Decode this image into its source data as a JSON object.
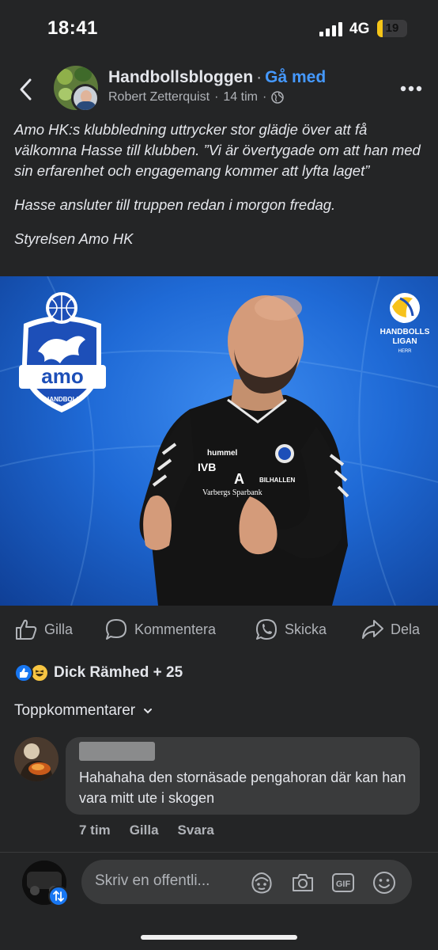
{
  "status_bar": {
    "time": "18:41",
    "network": "4G",
    "battery": "19",
    "battery_level": 0.19
  },
  "header": {
    "group_name": "Handbollsbloggen",
    "separator": "·",
    "join_label": "Gå med",
    "author": "Robert Zetterquist",
    "dot": "·",
    "time_ago": "14 tim",
    "back_icon": "chevron-left-icon",
    "more_icon": "more-horizontal-icon",
    "privacy_icon": "globe-icon"
  },
  "post": {
    "paragraphs": [
      "Amo HK:s klubbledning uttrycker stor glädje över att få välkomna  Hasse till klubben. ”Vi är övertygade om att han med sin erfarenhet och  engagemang kommer att lyfta laget”",
      "Hasse ansluter till truppen redan i morgon fredag.",
      "Styrelsen Amo HK"
    ],
    "image": {
      "club_logo_text": "amo",
      "club_logo_sub": "HANDBOLL",
      "league_logo_line1": "HANDBOLLS",
      "league_logo_line2": "LIGAN",
      "league_logo_line3": "HERR",
      "shirt_texts": [
        "hummel",
        "IVB",
        "A",
        "Varbergs Sparbank",
        "BILHALLEN"
      ]
    }
  },
  "actions": [
    {
      "label": "Gilla",
      "icon": "thumbs-up-icon"
    },
    {
      "label": "Kommentera",
      "icon": "comment-icon"
    },
    {
      "label": "Skicka",
      "icon": "whatsapp-icon"
    },
    {
      "label": "Dela",
      "icon": "share-icon"
    }
  ],
  "reactions": {
    "names": "Dick Rämhed + 25",
    "icons": [
      "like-reaction-icon",
      "haha-reaction-icon"
    ]
  },
  "comments": {
    "sort_label": "Toppkommentarer",
    "items": [
      {
        "text": "Hahahaha den stornäsade pengahoran där kan han vara mitt ute i skogen",
        "time": "7 tim",
        "like_label": "Gilla",
        "reply_label": "Svara"
      }
    ]
  },
  "composer": {
    "placeholder": "Skriv en offentli...",
    "icons": [
      "avatar-sticker-icon",
      "camera-icon",
      "gif-icon",
      "emoji-icon"
    ]
  },
  "colors": {
    "background": "#242526",
    "accent": "#4599ff",
    "bubble": "#3a3b3c",
    "secondary_text": "#b0b3b8"
  }
}
